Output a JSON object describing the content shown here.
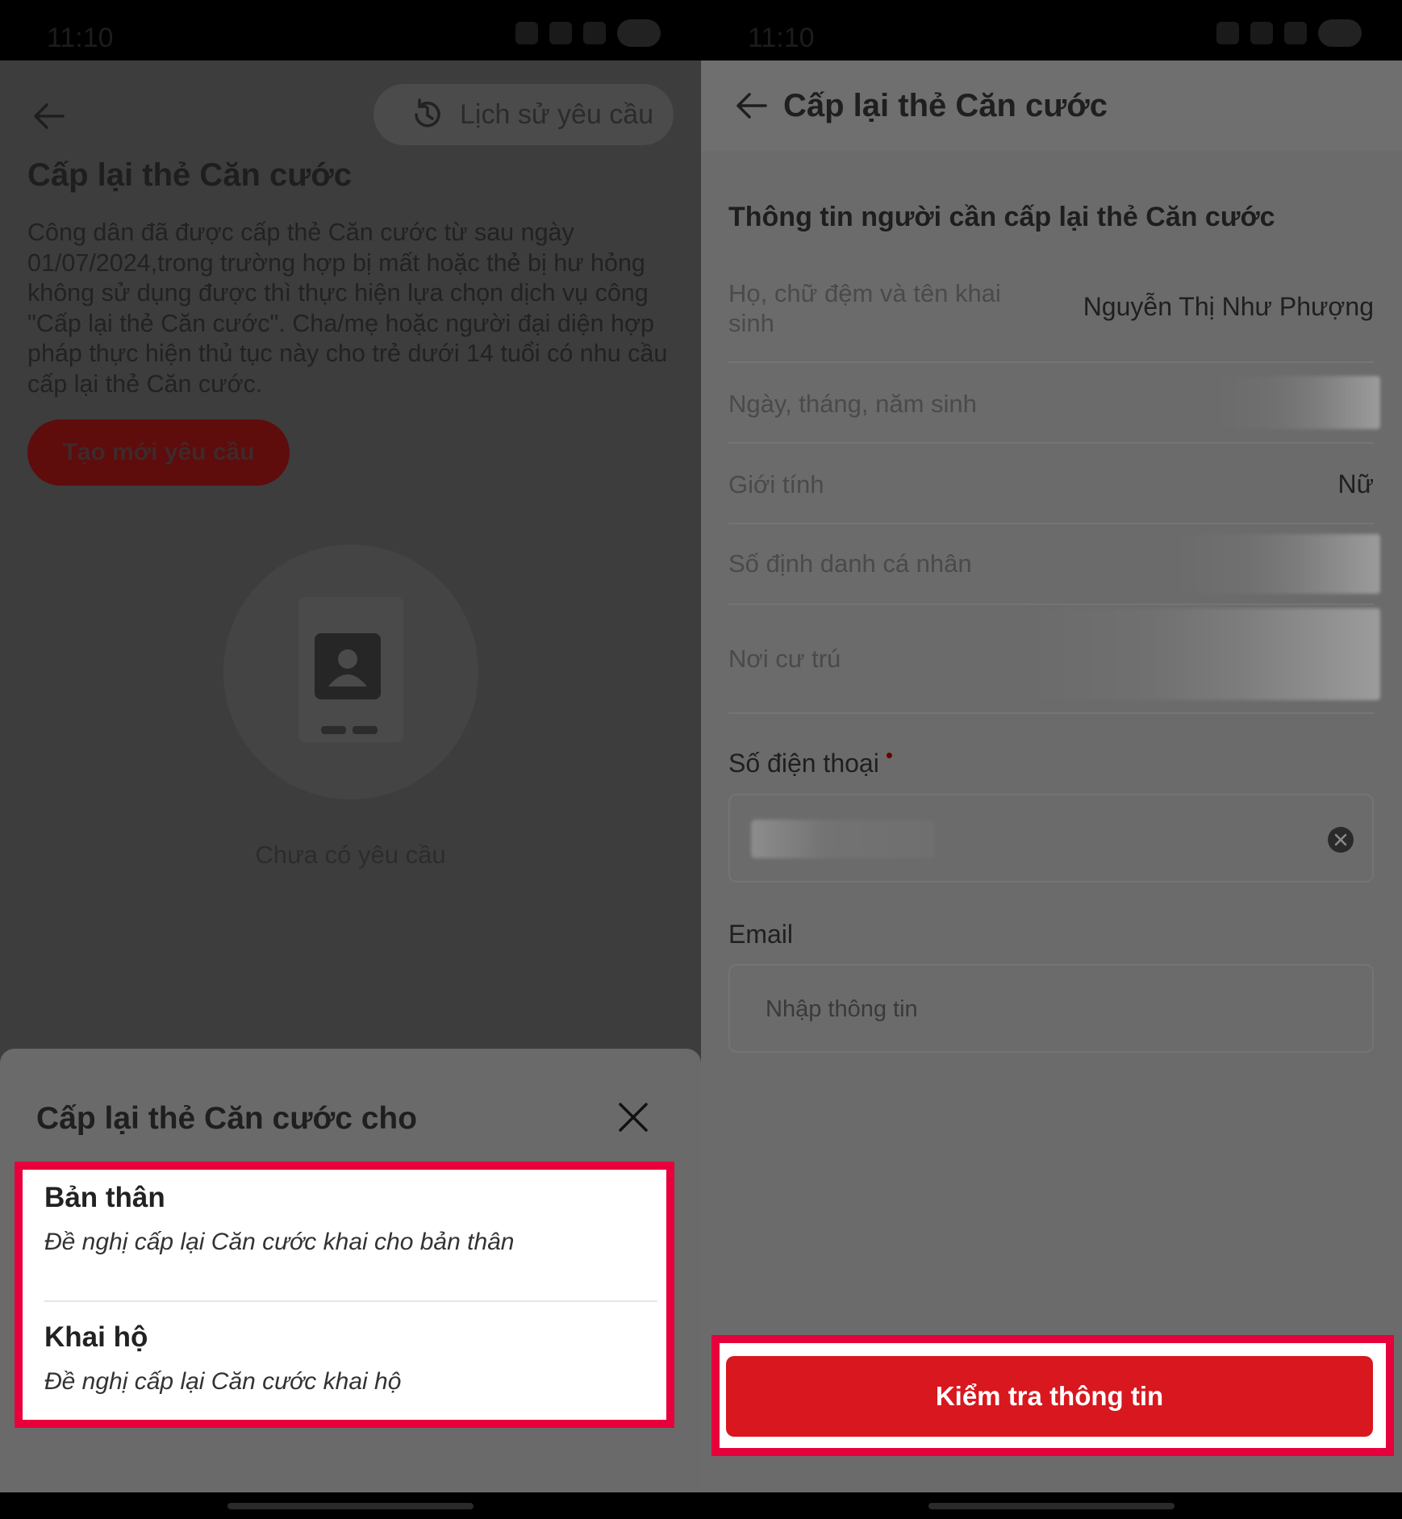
{
  "left_screen": {
    "status_time": "11:10",
    "history_button_label": "Lịch sử yêu cầu",
    "title": "Cấp lại thẻ Căn cước",
    "description": "Công dân đã được cấp thẻ Căn cước từ sau ngày 01/07/2024,trong trường hợp bị mất hoặc thẻ bị hư hỏng không sử dụng được thì thực hiện lựa chọn dịch vụ công \"Cấp lại thẻ Căn cước\". Cha/mẹ hoặc người đại diện hợp pháp thực hiện thủ tục này cho trẻ dưới 14 tuổi có nhu cầu cấp lại thẻ Căn cước.",
    "new_request_label": "Tạo mới yêu cầu",
    "empty_state_text": "Chưa có yêu cầu",
    "sheet": {
      "title": "Cấp lại thẻ Căn cước cho",
      "options": [
        {
          "title": "Bản thân",
          "subtitle": "Đề nghị cấp lại Căn cước khai cho bản thân"
        },
        {
          "title": "Khai hộ",
          "subtitle": "Đề nghị cấp lại Căn cước khai hộ"
        }
      ]
    }
  },
  "right_screen": {
    "status_time": "11:10",
    "header_title": "Cấp lại thẻ Căn cước",
    "section_title": "Thông tin người cần cấp lại thẻ Căn cước",
    "rows": [
      {
        "label": "Họ, chữ đệm và tên khai sinh",
        "value": "Nguyễn Thị Như Phượng"
      },
      {
        "label": "Ngày, tháng, năm sinh",
        "value": ""
      },
      {
        "label": "Giới tính",
        "value": "Nữ"
      },
      {
        "label": "Số định danh cá nhân",
        "value": ""
      },
      {
        "label": "Nơi cư trú",
        "value": ""
      }
    ],
    "phone_label": "Số điện thoại",
    "required_marker": "•",
    "email_label": "Email",
    "email_placeholder": "Nhập thông tin",
    "check_button_label": "Kiểm tra thông tin"
  },
  "colors": {
    "highlight_border": "#e7003b",
    "primary_button": "#d8171e",
    "overlay_bg": "#3d3d3d"
  }
}
